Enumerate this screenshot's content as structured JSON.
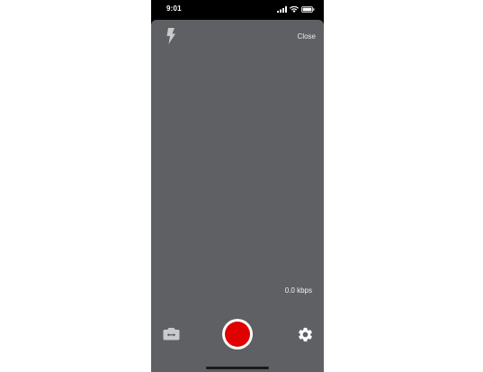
{
  "status_bar": {
    "time": "9:01",
    "icons": [
      "signal-icon",
      "wifi-icon",
      "battery-icon"
    ]
  },
  "top_controls": {
    "flash_icon": "flash-icon",
    "close_label": "Close"
  },
  "stats": {
    "bitrate": "0.0 kbps"
  },
  "bottom_controls": {
    "switch_camera_icon": "switch-camera-icon",
    "record_button_color": "#e00000",
    "settings_icon": "gear-icon"
  },
  "colors": {
    "camera_background": "#5e6063",
    "record": "#e00000"
  }
}
